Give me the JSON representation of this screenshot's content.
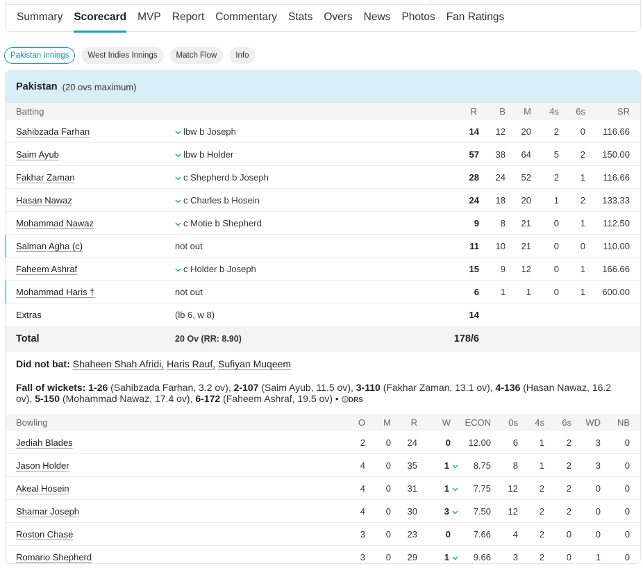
{
  "tabs": [
    "Summary",
    "Scorecard",
    "MVP",
    "Report",
    "Commentary",
    "Stats",
    "Overs",
    "News",
    "Photos",
    "Fan Ratings"
  ],
  "pills": [
    "Pakistan Innings",
    "West Indies Innings",
    "Match Flow",
    "Info"
  ],
  "innings": {
    "team": "Pakistan",
    "overs_note": "(20 ovs maximum)"
  },
  "batting_header": {
    "label": "Batting",
    "cols": [
      "R",
      "B",
      "M",
      "4s",
      "6s",
      "SR"
    ]
  },
  "batters": [
    {
      "name": "Sahibzada Farhan",
      "dismissal": "lbw b Joseph",
      "r": "14",
      "b": "12",
      "m": "20",
      "fours": "2",
      "sixes": "0",
      "sr": "116.66"
    },
    {
      "name": "Saim Ayub",
      "dismissal": "lbw b Holder",
      "r": "57",
      "b": "38",
      "m": "64",
      "fours": "5",
      "sixes": "2",
      "sr": "150.00"
    },
    {
      "name": "Fakhar Zaman",
      "dismissal": "c Shepherd b Joseph",
      "r": "28",
      "b": "24",
      "m": "52",
      "fours": "2",
      "sixes": "1",
      "sr": "116.66"
    },
    {
      "name": "Hasan Nawaz",
      "dismissal": "c Charles b Hosein",
      "r": "24",
      "b": "18",
      "m": "20",
      "fours": "1",
      "sixes": "2",
      "sr": "133.33"
    },
    {
      "name": "Mohammad Nawaz",
      "dismissal": "c Motie b Shepherd",
      "r": "9",
      "b": "8",
      "m": "21",
      "fours": "0",
      "sixes": "1",
      "sr": "112.50"
    },
    {
      "name": "Salman Agha (c)",
      "dismissal": "not out",
      "r": "11",
      "b": "10",
      "m": "21",
      "fours": "0",
      "sixes": "0",
      "sr": "110.00"
    },
    {
      "name": "Faheem Ashraf",
      "dismissal": "c Holder b Joseph",
      "r": "15",
      "b": "9",
      "m": "12",
      "fours": "0",
      "sixes": "1",
      "sr": "166.66"
    },
    {
      "name": "Mohammad Haris †",
      "dismissal": "not out",
      "r": "6",
      "b": "1",
      "m": "1",
      "fours": "0",
      "sixes": "1",
      "sr": "600.00"
    }
  ],
  "extras": {
    "label": "Extras",
    "detail": "(lb 6, w 8)",
    "runs": "14"
  },
  "total": {
    "label": "Total",
    "detail": "20 Ov (RR: 8.90)",
    "score": "178/6"
  },
  "did_not_bat": {
    "label": "Did not bat:",
    "players": [
      "Shaheen Shah Afridi,",
      "Haris Rauf,",
      "Sufiyan Muqeem"
    ]
  },
  "fall_of_wickets": {
    "label": "Fall of wickets:",
    "items": [
      {
        "score": "1-26",
        "detail": "(Sahibzada Farhan, 3.2 ov),",
        "gap": " "
      },
      {
        "score": "2-107",
        "detail": "(Saim Ayub, 11.5 ov),",
        "gap": " "
      },
      {
        "score": "3-110",
        "detail": "(Fakhar Zaman, 13.1 ov),",
        "gap": " "
      },
      {
        "score": "4-136",
        "detail": "(Hasan Nawaz, 16.2 ov),",
        "gap": " "
      },
      {
        "score": "5-150",
        "detail": "(Mohammad Nawaz, 17.4 ov),",
        "gap": " "
      },
      {
        "score": "6-172",
        "detail": "(Faheem Ashraf, 19.5 ov)",
        "gap": " • "
      }
    ],
    "drs": "DRS"
  },
  "bowling_header": {
    "label": "Bowling",
    "cols": [
      "O",
      "M",
      "R",
      "W",
      "ECON",
      "0s",
      "4s",
      "6s",
      "WD",
      "NB"
    ]
  },
  "bowlers": [
    {
      "name": "Jediah Blades",
      "o": "2",
      "m": "0",
      "r": "24",
      "w": "0",
      "econ": "12.00",
      "dots": "6",
      "fours": "1",
      "sixes": "2",
      "wd": "3",
      "nb": "0",
      "has_wkts": false
    },
    {
      "name": "Jason Holder",
      "o": "4",
      "m": "0",
      "r": "35",
      "w": "1",
      "econ": "8.75",
      "dots": "8",
      "fours": "1",
      "sixes": "2",
      "wd": "3",
      "nb": "0",
      "has_wkts": true
    },
    {
      "name": "Akeal Hosein",
      "o": "4",
      "m": "0",
      "r": "31",
      "w": "1",
      "econ": "7.75",
      "dots": "12",
      "fours": "2",
      "sixes": "2",
      "wd": "0",
      "nb": "0",
      "has_wkts": true
    },
    {
      "name": "Shamar Joseph",
      "o": "4",
      "m": "0",
      "r": "30",
      "w": "3",
      "econ": "7.50",
      "dots": "12",
      "fours": "2",
      "sixes": "2",
      "wd": "0",
      "nb": "0",
      "has_wkts": true
    },
    {
      "name": "Roston Chase",
      "o": "3",
      "m": "0",
      "r": "23",
      "w": "0",
      "econ": "7.66",
      "dots": "4",
      "fours": "2",
      "sixes": "0",
      "wd": "0",
      "nb": "0",
      "has_wkts": false
    },
    {
      "name": "Romario Shepherd",
      "o": "3",
      "m": "0",
      "r": "29",
      "w": "1",
      "econ": "9.66",
      "dots": "3",
      "fours": "2",
      "sixes": "0",
      "wd": "1",
      "nb": "0",
      "has_wkts": true
    }
  ],
  "colors": {
    "accent": "#0ca3c9",
    "innings_header_bg": "#d8eef9",
    "row_header_bg": "#f5f5f5"
  },
  "icons": {
    "dismissal_expand": "chevron-down-icon",
    "drs": "info-circle-icon"
  }
}
